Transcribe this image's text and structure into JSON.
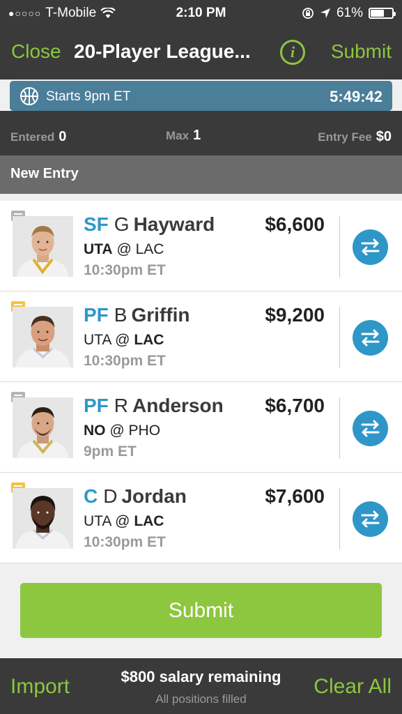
{
  "status_bar": {
    "signal": "●○○○○",
    "carrier": "T-Mobile",
    "time": "2:10 PM",
    "battery": "61%",
    "icons": [
      "wifi-icon",
      "lock-rotation-icon",
      "location-arrow-icon",
      "battery-icon"
    ]
  },
  "nav": {
    "close_label": "Close",
    "title": "20-Player League...",
    "info_label": "i",
    "submit_label": "Submit"
  },
  "contest": {
    "starts_label": "Starts 9pm ET",
    "countdown": "5:49:42",
    "entered_label": "Entered",
    "entered_value": "0",
    "max_label": "Max",
    "max_value": "1",
    "fee_label": "Entry Fee",
    "fee_value": "$0"
  },
  "section": {
    "title": "New Entry"
  },
  "players": [
    {
      "position": "SF",
      "initial": "G",
      "name": "Hayward",
      "salary": "$6,600",
      "away": "UTA",
      "at": "@",
      "home": "LAC",
      "bold_team": "away",
      "time": "10:30pm ET",
      "note": "grey"
    },
    {
      "position": "PF",
      "initial": "B",
      "name": "Griffin",
      "salary": "$9,200",
      "away": "UTA",
      "at": "@",
      "home": "LAC",
      "bold_team": "home",
      "time": "10:30pm ET",
      "note": "yellow"
    },
    {
      "position": "PF",
      "initial": "R",
      "name": "Anderson",
      "salary": "$6,700",
      "away": "NO",
      "at": "@",
      "home": "PHO",
      "bold_team": "away",
      "time": "9pm ET",
      "note": "grey"
    },
    {
      "position": "C",
      "initial": "D",
      "name": "Jordan",
      "salary": "$7,600",
      "away": "UTA",
      "at": "@",
      "home": "LAC",
      "bold_team": "home",
      "time": "10:30pm ET",
      "note": "yellow"
    }
  ],
  "submit_button_label": "Submit",
  "footer": {
    "import_label": "Import",
    "salary_remaining": "$800 salary remaining",
    "positions_status": "All positions filled",
    "clear_label": "Clear All"
  },
  "colors": {
    "accent_green": "#8dc63f",
    "position_blue": "#2e97c8",
    "dark_bar": "#3a3a3a",
    "start_bar": "#4a7e99",
    "note_yellow": "#f5c242",
    "note_grey": "#b3b3b3"
  }
}
